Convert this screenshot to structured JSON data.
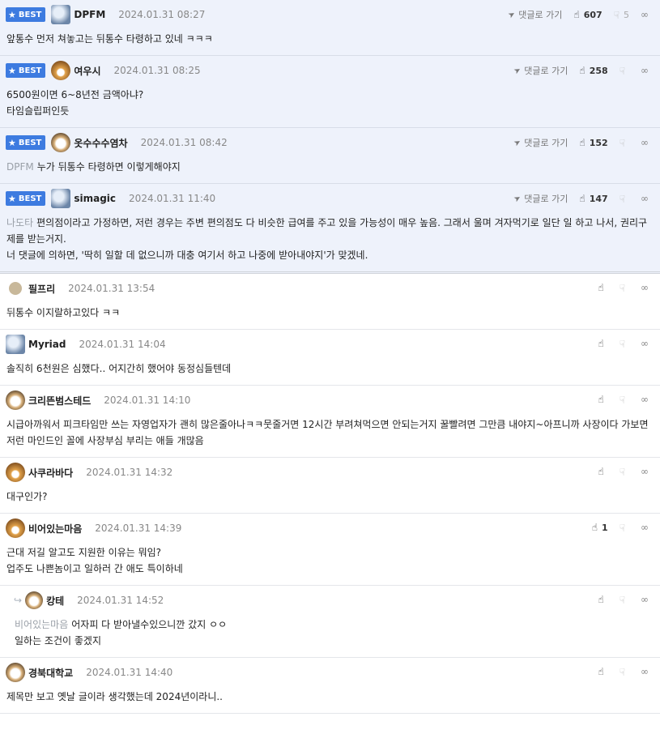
{
  "labels": {
    "best": "BEST",
    "goto": "댓글로 가기"
  },
  "comments": [
    {
      "best": true,
      "avatar": "blue",
      "nick": "DPFM",
      "date": "2024.01.31 08:27",
      "up": "607",
      "down": "5",
      "mention": "",
      "lines": [
        "앞통수 먼저 쳐놓고는 뒤통수 타령하고 있네 ㅋㅋㅋ"
      ]
    },
    {
      "best": true,
      "avatar": "fox",
      "nick": "여우시",
      "date": "2024.01.31 08:25",
      "up": "258",
      "down": "",
      "mention": "",
      "lines": [
        "6500원이면 6~8년전 금액아냐?",
        "타임슬립퍼인듯"
      ]
    },
    {
      "best": true,
      "avatar": "shiba",
      "nick": "옷수수수염차",
      "date": "2024.01.31 08:42",
      "up": "152",
      "down": "",
      "mention": "DPFM",
      "lines": [
        "누가 뒤통수 타령하면 이렇게해야지"
      ]
    },
    {
      "best": true,
      "avatar": "blue",
      "nick": "simagic",
      "date": "2024.01.31 11:40",
      "up": "147",
      "down": "",
      "mention": "나도타",
      "lines": [
        "편의점이라고 가정하면, 저런 경우는 주변 편의점도 다 비슷한 급여를 주고 있을 가능성이 매우 높음. 그래서 울며 겨자먹기로 일단 일 하고 나서, 권리구제를 받는거지.",
        "너 댓글에 의하면, '딱히 일할 데 없으니까 대충 여기서 하고 나중에 받아내야지'가 맞겠네."
      ]
    },
    {
      "best": false,
      "avatar": "dot",
      "nick": "필프리",
      "date": "2024.01.31 13:54",
      "up": "",
      "down": "",
      "mention": "",
      "lines": [
        "뒤통수 이지랄하고있다 ㅋㅋ"
      ]
    },
    {
      "best": false,
      "avatar": "blue",
      "nick": "Myriad",
      "date": "2024.01.31 14:04",
      "up": "",
      "down": "",
      "mention": "",
      "lines": [
        "솔직히 6천원은 심했다.. 어지간히 했어야 동정심들텐데"
      ]
    },
    {
      "best": false,
      "avatar": "shiba",
      "nick": "크리뜬범스테드",
      "date": "2024.01.31 14:10",
      "up": "",
      "down": "",
      "mention": "",
      "lines": [
        "시급아까워서 피크타임만 쓰는 자영업자가 괜히 많은줄아나ㅋㅋ뭇줄거면 12시간 부려쳐먹으면 안되는거지 꿀빨려면 그만큼 내야지~아프니까 사장이다 가보면 저런 마인드인 꼴에 사장부심 부리는 애들 개많음"
      ]
    },
    {
      "best": false,
      "avatar": "fox",
      "nick": "사쿠라바다",
      "date": "2024.01.31 14:32",
      "up": "",
      "down": "",
      "mention": "",
      "lines": [
        "대구인가?"
      ]
    },
    {
      "best": false,
      "avatar": "fox",
      "nick": "비어있는마음",
      "date": "2024.01.31 14:39",
      "up": "1",
      "down": "",
      "mention": "",
      "lines": [
        "근대 저길 알고도 지원한 이유는 뭐임?",
        "업주도 나쁜놈이고 일하러 간 애도 특이하네"
      ]
    },
    {
      "best": false,
      "reply": true,
      "avatar": "shiba",
      "nick": "캉테",
      "date": "2024.01.31 14:52",
      "up": "",
      "down": "",
      "mention": "비어있는마음",
      "lines": [
        "어자피 다 받아낼수있으니깐 갔지 ㅇㅇ",
        "일하는 조건이 좋겠지"
      ]
    },
    {
      "best": false,
      "avatar": "shiba",
      "nick": "경북대학교",
      "date": "2024.01.31 14:40",
      "up": "",
      "down": "",
      "mention": "",
      "lines": [
        "제목만 보고 옛날 글이라 생각했는데 2024년이라니.."
      ]
    }
  ]
}
